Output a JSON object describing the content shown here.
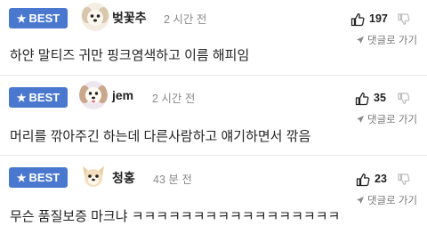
{
  "badge_label": "BEST",
  "reply_label": "댓글로 가기",
  "comments": [
    {
      "nickname": "벚꽃추",
      "time": "2 시간 전",
      "likes": "197",
      "text": "하얀 말티즈 귀만 핑크염색하고 이름 해피임"
    },
    {
      "nickname": "jem",
      "time": "2 시간 전",
      "likes": "35",
      "text": "머리를 깎아주긴 하는데 다른사람하고 얘기하면서 깎음"
    },
    {
      "nickname": "청홍",
      "time": "43 분 전",
      "likes": "23",
      "text": "무슨 품질보증 마크냐 ㅋㅋㅋㅋㅋㅋㅋㅋㅋㅋㅋㅋㅋㅋㅋㅋㅋ"
    }
  ]
}
